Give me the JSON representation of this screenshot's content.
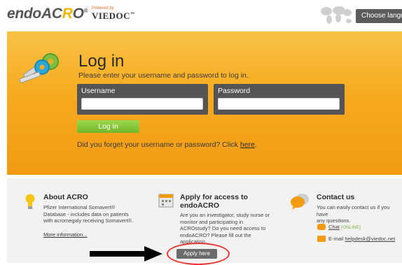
{
  "header": {
    "logo_text": "endoACRO",
    "trademark": "®",
    "powered_by": "Powered by",
    "vendor": "VIEDOC",
    "vendor_tm": "™",
    "language_button": "Choose language"
  },
  "login": {
    "title": "Log in",
    "subtitle": "Please enter your username and password to log in.",
    "username_label": "Username",
    "username_value": "",
    "password_label": "Password",
    "password_value": "",
    "login_button": "Log in",
    "forgot_text": "Did you forget your username or password? Click",
    "forgot_link": "here",
    "forgot_end": "."
  },
  "about": {
    "title": "About ACRO",
    "text_lines": [
      "Pfizer International Somavert®",
      "Database - includes data on patients",
      "with acromegaly receiving Somavert®."
    ],
    "link": "More information..."
  },
  "apply": {
    "title_line1": "Apply for access to",
    "title_line2": "endoACRO",
    "text_lines": [
      "Are you an investigator, study nurse or",
      "monitor and participating in",
      "ACROstudy? Do you need access to",
      "endoACRO? Please fill out the",
      "application."
    ],
    "button": "Apply here"
  },
  "contact": {
    "title": "Contact us",
    "text_lines": [
      "You can easily contact us if you have",
      "any questions."
    ],
    "chat_label": "Chat",
    "chat_status": "[ONLINE]",
    "email_label": "E-mail",
    "email": "helpdesk@viedoc.net"
  },
  "colors": {
    "accent_orange": "#f6aa1f",
    "login_green": "#71b72a",
    "annotation_red": "#e53935"
  }
}
